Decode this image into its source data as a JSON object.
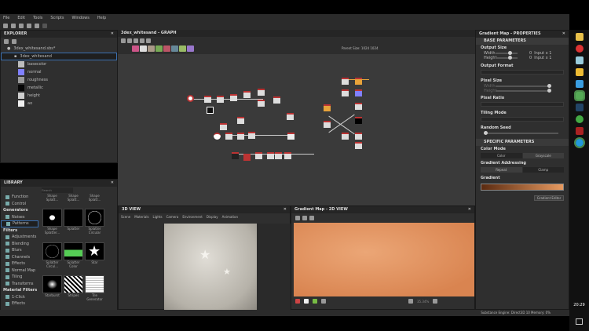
{
  "menu": [
    "File",
    "Edit",
    "Tools",
    "Scripts",
    "Windows",
    "Help"
  ],
  "explorer": {
    "title": "EXPLORER",
    "package": "3dex_whitesand.sbs*",
    "graph": "3dex_whitesand",
    "outputs": [
      {
        "label": "basecolor",
        "color": "#bdbdbd"
      },
      {
        "label": "normal",
        "color": "#8080ff"
      },
      {
        "label": "roughness",
        "color": "#9a9a9a"
      },
      {
        "label": "metallic",
        "color": "#050505"
      },
      {
        "label": "height",
        "color": "#cfcfcf"
      },
      {
        "label": "ao",
        "color": "#f0f0f0"
      }
    ]
  },
  "graph": {
    "title": "3dex_whitesand - GRAPH",
    "toolbar_text": "Parent Size: 1024  1024"
  },
  "library": {
    "title": "LIBRARY",
    "search_placeholder": "Search",
    "categories": [
      {
        "label": "Function"
      },
      {
        "label": "Control"
      },
      {
        "label": "Generators",
        "header": true
      },
      {
        "label": "Noises"
      },
      {
        "label": "Patterns",
        "selected": true
      },
      {
        "label": "Filters",
        "header": true
      },
      {
        "label": "Adjustments"
      },
      {
        "label": "Blending"
      },
      {
        "label": "Blurs"
      },
      {
        "label": "Channels"
      },
      {
        "label": "Effects"
      },
      {
        "label": "Normal Map"
      },
      {
        "label": "Tiling"
      },
      {
        "label": "Transforms"
      },
      {
        "label": "Material Filters",
        "header": true
      },
      {
        "label": "1-Click"
      },
      {
        "label": "Effects"
      }
    ],
    "items": [
      "Shape Splatt...",
      "Shape Splatt...",
      "Shape Splatt...",
      "Shape Splatter...",
      "Splatter",
      "Splatter Circular",
      "Splatter Circul...",
      "Splatter Color",
      "Star",
      "Starburst",
      "Stripes",
      "Tile Generator"
    ]
  },
  "view3d": {
    "title": "3D VIEW",
    "menu": [
      "Scene",
      "Materials",
      "Lights",
      "Camera",
      "Environment",
      "Display",
      "Animation"
    ]
  },
  "view2d": {
    "title": "Gradient Map - 2D VIEW",
    "zoom": "35.34%"
  },
  "properties": {
    "title": "Gradient Map - PROPERTIES",
    "base_title": "BASE PARAMETERS",
    "output_size": {
      "label": "Output Size",
      "width_label": "Width",
      "height_label": "Height",
      "width_value": "0",
      "height_value": "0",
      "width_mode": "Input x 1",
      "height_mode": "Input x 1"
    },
    "output_format": "Output Format",
    "pixel_size": {
      "label": "Pixel Size",
      "width_label": "Width",
      "height_label": "Height"
    },
    "pixel_ratio": "Pixel Ratio",
    "tiling_mode": "Tiling Mode",
    "random_seed": "Random Seed",
    "specific_title": "SPECIFIC PARAMETERS",
    "color_mode": {
      "label": "Color Mode",
      "options": [
        "Color",
        "Grayscale"
      ]
    },
    "addressing": {
      "label": "Gradient Addressing",
      "options": [
        "Repeat",
        "Clamp"
      ]
    },
    "gradient": {
      "label": "Gradient",
      "start": "#5a2a10",
      "end": "#e89a60"
    },
    "editor_button": "Gradient Editor"
  },
  "status": {
    "engine": "Substance Engine: Direct3D 10  Memory: 0%",
    "clock": "20:29"
  },
  "colors": {
    "accent": "#e08a3e",
    "panel": "#2f2f2f"
  }
}
